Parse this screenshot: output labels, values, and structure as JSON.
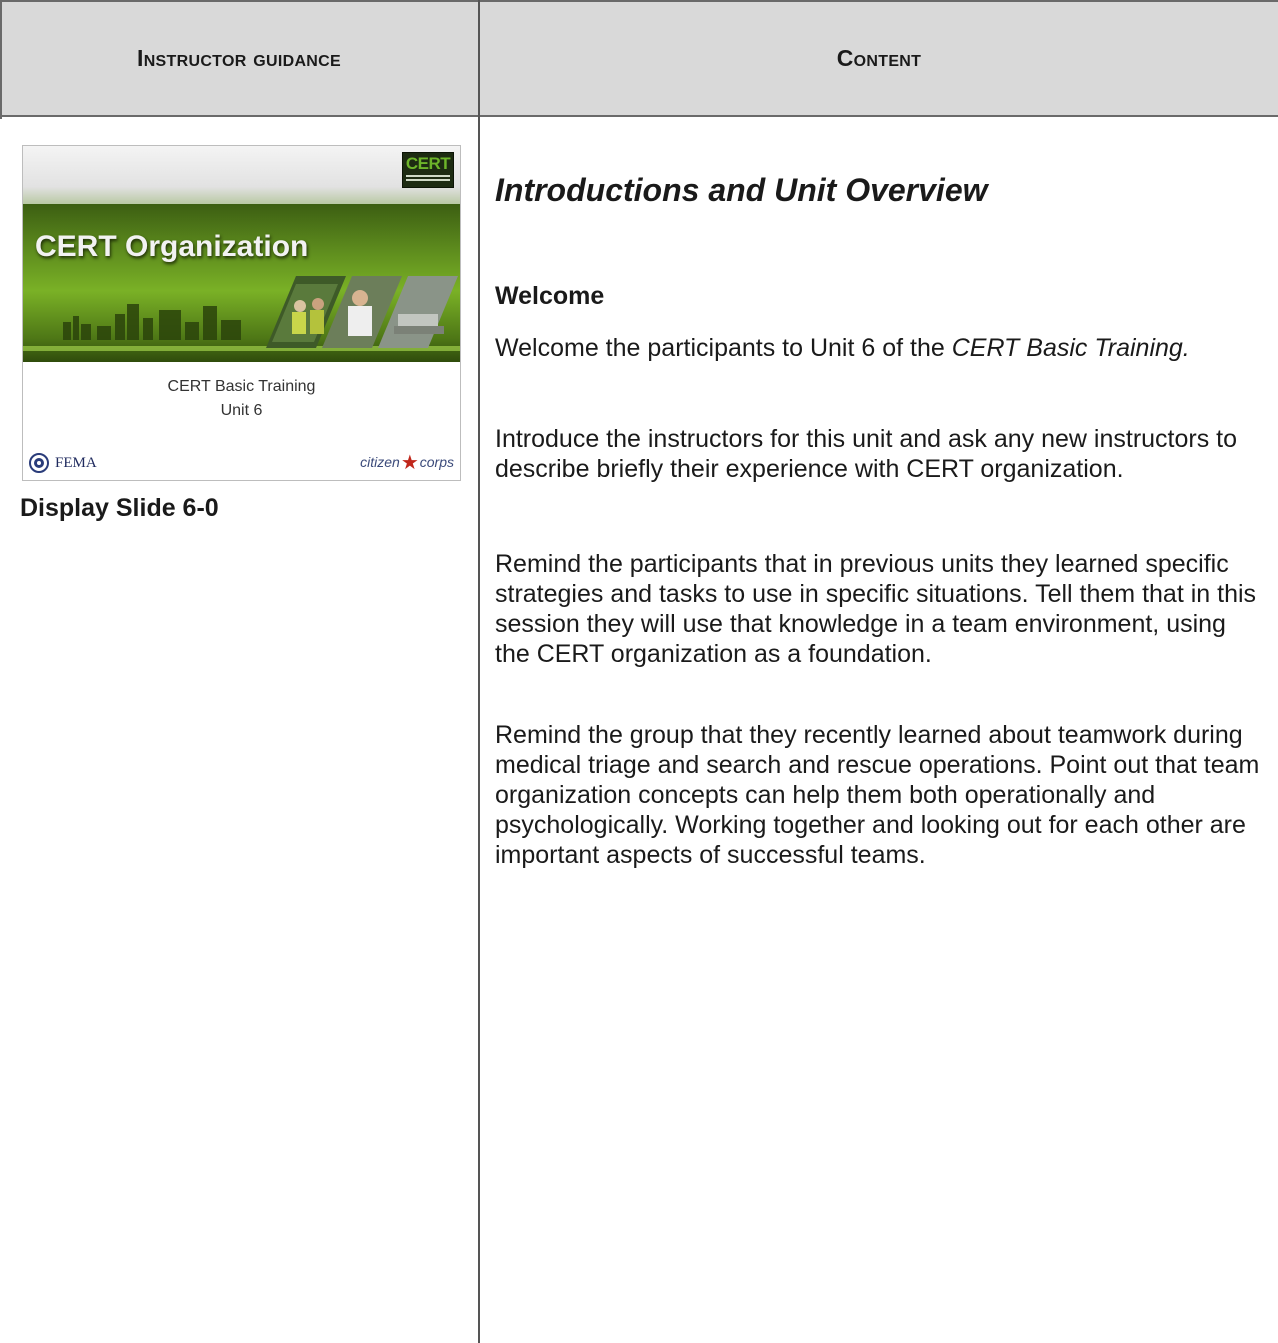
{
  "header": {
    "left": "Instructor guidance",
    "right": "Content"
  },
  "slide": {
    "title": "CERT Organization",
    "subtitle_line1": "CERT Basic Training",
    "subtitle_line2": "Unit 6",
    "logo_text": "CERT",
    "fema_label": "FEMA",
    "citizen_corps_left": "citizen",
    "citizen_corps_right": "corps"
  },
  "left_column": {
    "display_slide": "Display Slide 6-0"
  },
  "content": {
    "section_title": "Introductions and Unit Overview",
    "welcome_heading": "Welcome",
    "p1_prefix": "Welcome the participants to Unit 6 of the ",
    "p1_italic": "CERT Basic Training.",
    "p2": "Introduce the instructors for this unit and ask any new instructors to describe briefly their experience with CERT organization.",
    "p3": "Remind the participants that in previous units they learned specific strategies and tasks to use in specific situations.  Tell them that in this session they will use that knowledge in a team environment, using the CERT organization as a foundation.",
    "p4": "Remind the group that they recently learned about teamwork during medical triage and search and rescue operations.  Point out that team organization concepts can help them both operationally and psychologically.  Working together and looking out for each other are important aspects of successful teams."
  }
}
